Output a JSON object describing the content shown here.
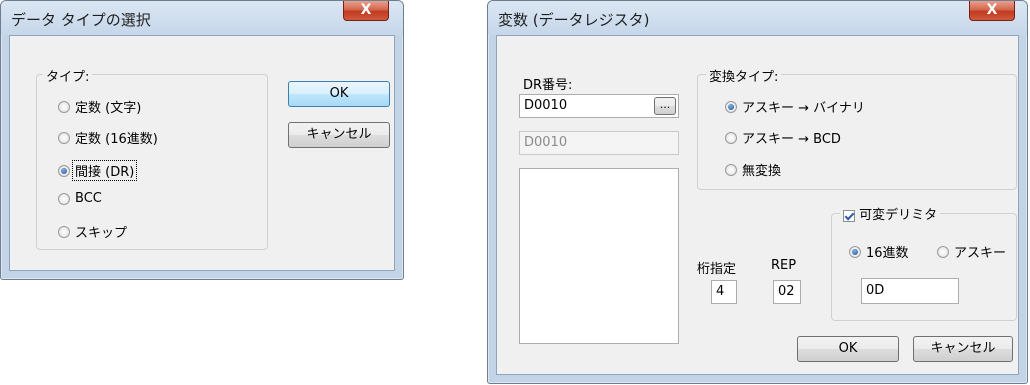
{
  "dialog1": {
    "title": "データ タイプの選択",
    "close_label": "X",
    "group_label": "タイプ:",
    "options": [
      {
        "label": "定数 (文字)",
        "selected": false
      },
      {
        "label": "定数 (16進数)",
        "selected": false
      },
      {
        "label": "間接 (DR)",
        "selected": true
      },
      {
        "label": "BCC",
        "selected": false
      },
      {
        "label": "スキップ",
        "selected": false
      }
    ],
    "ok_label": "OK",
    "cancel_label": "キャンセル"
  },
  "dialog2": {
    "title": "変数 (データレジスタ)",
    "close_label": "X",
    "dr_label": "DR番号:",
    "dr_value": "D0010",
    "browse_label": "...",
    "dr_readonly": "D0010",
    "convert_group_label": "変換タイプ:",
    "convert_options": [
      {
        "label": "アスキー → バイナリ",
        "selected": true
      },
      {
        "label": "アスキー → BCD",
        "selected": false
      },
      {
        "label": "無変換",
        "selected": false
      }
    ],
    "variable_delimiter_label": "可変デリミタ",
    "variable_delimiter_checked": true,
    "delimiter_format": [
      {
        "label": "16進数",
        "selected": true
      },
      {
        "label": "アスキー",
        "selected": false
      }
    ],
    "delimiter_value": "0D",
    "digits_label": "桁指定",
    "digits_value": "4",
    "rep_label": "REP",
    "rep_value": "02",
    "ok_label": "OK",
    "cancel_label": "キャンセル"
  }
}
